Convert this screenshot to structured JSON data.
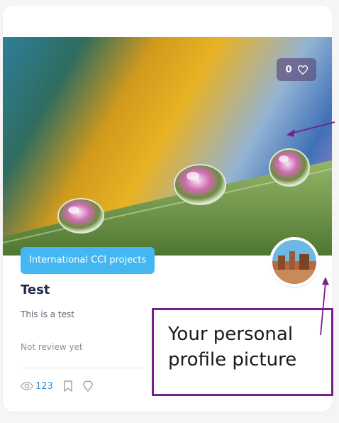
{
  "card": {
    "likes_count": "0",
    "category": "International CCI projects",
    "title": "Test",
    "description": "This is a test",
    "review_status": "Not review yet",
    "views_count": "123"
  },
  "annotation": {
    "line1": "Your personal",
    "line2": "profile picture"
  },
  "icons": [
    "heart-icon",
    "eye-icon",
    "bookmark-icon",
    "pin-icon"
  ],
  "colors": {
    "category_badge": "#44b7f2",
    "views_text": "#2f8fd6",
    "annotation_border": "#7a1e8c"
  }
}
